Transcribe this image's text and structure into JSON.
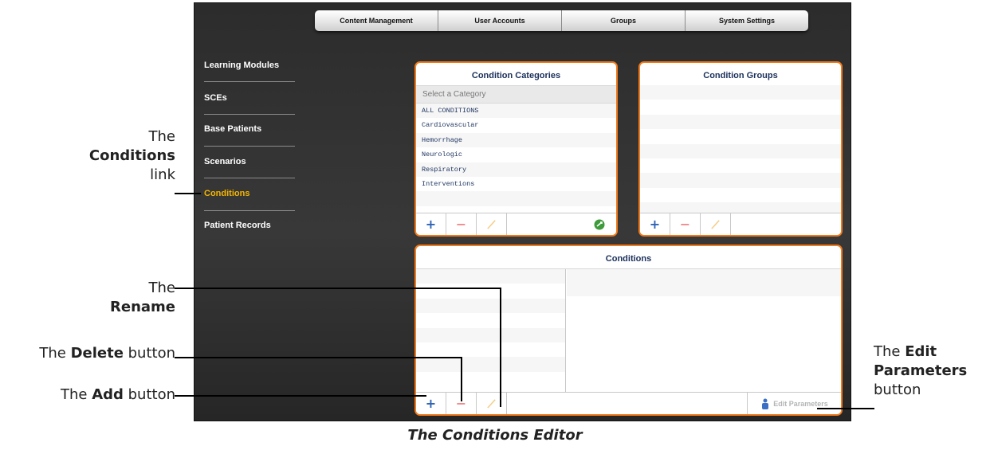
{
  "tabs": [
    "Content Management",
    "User Accounts",
    "Groups",
    "System Settings"
  ],
  "nav": {
    "items": [
      {
        "label": "Learning Modules",
        "active": false
      },
      {
        "label": "SCEs",
        "active": false
      },
      {
        "label": "Base Patients",
        "active": false
      },
      {
        "label": "Scenarios",
        "active": false
      },
      {
        "label": "Conditions",
        "active": true
      },
      {
        "label": "Patient Records",
        "active": false
      }
    ]
  },
  "condition_categories": {
    "title": "Condition Categories",
    "placeholder": "Select a Category",
    "items": [
      "ALL CONDITIONS",
      "Cardiovascular",
      "Hemorrhage",
      "Neurologic",
      "Respiratory",
      "Interventions"
    ]
  },
  "condition_groups": {
    "title": "Condition Groups"
  },
  "conditions": {
    "title": "Conditions",
    "edit_parameters_label": "Edit Parameters"
  },
  "toolbar": {
    "add_symbol": "+",
    "delete_symbol": "−"
  },
  "callouts": {
    "conditions_link": {
      "line1": "The",
      "line2": "Conditions",
      "line3": "link"
    },
    "rename": {
      "line1": "The",
      "line2": "Rename"
    },
    "delete": {
      "prefix": "The ",
      "bold": "Delete",
      "suffix": " button"
    },
    "add": {
      "prefix": "The ",
      "bold": "Add",
      "suffix": " button"
    },
    "edit_params": {
      "prefix": "The ",
      "bold1": "Edit",
      "bold2": "Parameters",
      "suffix": "button"
    }
  },
  "caption": "The Conditions Editor",
  "colors": {
    "accent": "#f07a1c",
    "active_nav": "#f5b400",
    "add_icon": "#2f63b4",
    "delete_icon": "#ef8a8a"
  }
}
